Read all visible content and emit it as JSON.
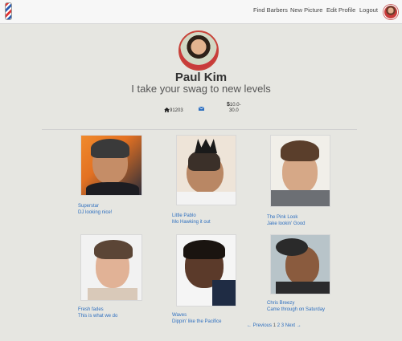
{
  "nav": {
    "find_barbers": "Find Barbers",
    "new_picture": "New Picture",
    "edit_profile": "Edit Profile",
    "logout": "Logout"
  },
  "profile": {
    "name": "Paul Kim",
    "tagline": "I take your swag to new levels",
    "zip": "91203",
    "price_symbol": "$",
    "price_range": "10.0-",
    "price_range_2": "30.0"
  },
  "gallery": [
    {
      "title": "Superstar",
      "caption": "DJ looking nice!"
    },
    {
      "title": "Little Pablo",
      "caption": "Mo Hawking it out"
    },
    {
      "title": "The Pink Look",
      "caption": "Jake lookin' Good"
    },
    {
      "title": "Fresh fades",
      "caption": "This is what we do"
    },
    {
      "title": "Waves",
      "caption": "Dippin' like the Pacifice"
    },
    {
      "title": "Chris Breezy",
      "caption": "Came through on Saturday"
    }
  ],
  "pagination": {
    "prev": "← Previous",
    "p1": "1",
    "p2": "2",
    "p3": "3",
    "next": "Next →"
  },
  "colors": {
    "link": "#2e6fbf",
    "background": "#e6e6e1",
    "navbar": "#f7f7f7"
  },
  "icons": {
    "home": "home-icon",
    "mail": "mail-icon"
  }
}
